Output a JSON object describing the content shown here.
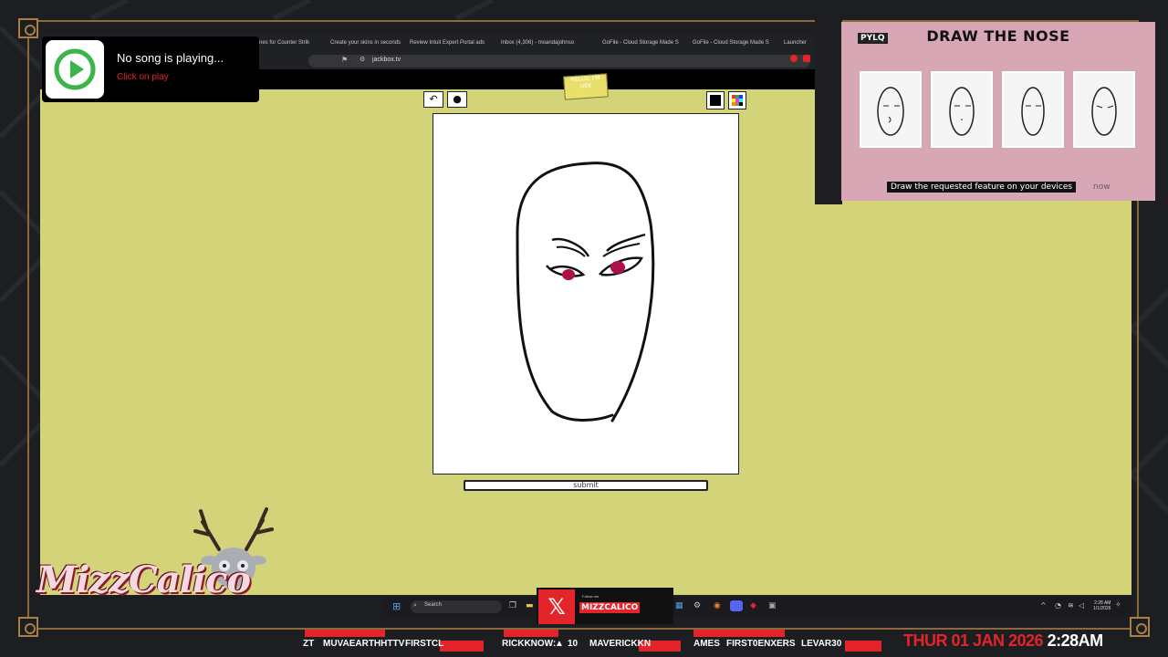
{
  "browser": {
    "tabs": [
      "nes for Counter Strik",
      "Create your skins in seconds",
      "Review Intuit Expert Portal ads",
      "Inbox (4,306) - moandajohnso",
      "GoFile - Cloud Storage Made S",
      "GoFile - Cloud Storage Made S",
      "Launcher"
    ],
    "url": "jackbox.tv"
  },
  "now_playing": {
    "title": "No song is playing...",
    "subtitle": "Click on play",
    "icon": "play-logo-icon",
    "accent": "#e3242b"
  },
  "drawing": {
    "sticker_text": "HELLO, I'M\nGEX",
    "undo_icon": "undo-icon",
    "brush_icon": "brush-size-icon",
    "color_icon": "black-swatch-icon",
    "palette_icon": "palette-icon",
    "submit_label": "submit",
    "background": "#d3d37a"
  },
  "overlay": {
    "logo": "PYLQ",
    "title": "DRAW THE NOSE",
    "caption": "Draw the requested feature on your devices",
    "caption_tail": "now",
    "cards": [
      "face-card-1",
      "face-card-2",
      "face-card-3",
      "face-card-4"
    ]
  },
  "taskbar": {
    "search_placeholder": "Search",
    "time": "2:28 AM",
    "date": "1/1/2026"
  },
  "promo": {
    "platform_icon": "x-logo-icon",
    "follow_text": "Follow me",
    "handle": "MIZZCALICO"
  },
  "ticker": {
    "items": [
      "ZT",
      "MUVAEARTHHTTV",
      "FIRSTCL",
      "RICKKNOW:",
      "10",
      "MAVERICKKN",
      "AMES",
      "FIRST0ENXERS",
      "LEVAR30"
    ],
    "date": "THUR 01 JAN 2026",
    "time": "2:28AM"
  },
  "branding": {
    "logo_text": "MizzCalico",
    "mascot": "deer-mascot-icon"
  }
}
